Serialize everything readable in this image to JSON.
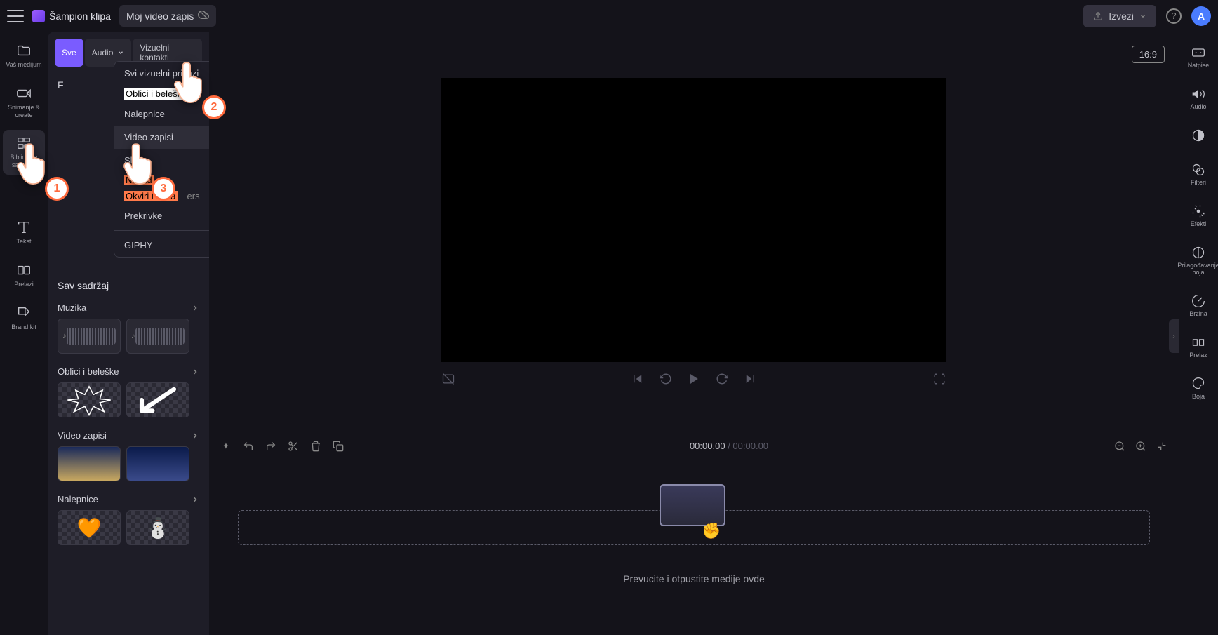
{
  "header": {
    "app_name": "Šampion klipa",
    "project_name": "Moj video zapis",
    "export_label": "Izvezi",
    "avatar_letter": "A"
  },
  "left_rail": [
    {
      "label": "Vaš medijum",
      "icon": "folder"
    },
    {
      "label": "Snimanje &amp; create",
      "icon": "camera"
    },
    {
      "label": "Biblioteka sadržaja",
      "icon": "library",
      "active": true
    },
    {
      "label": "",
      "icon": "spacer"
    },
    {
      "label": "Tekst",
      "icon": "text"
    },
    {
      "label": "Prelazi",
      "icon": "transitions"
    },
    {
      "label": "Brand kit",
      "icon": "brandkit"
    }
  ],
  "filter_tabs": {
    "all": "Sve",
    "audio": "Audio",
    "visuals": "Vizuelni kontakti"
  },
  "dropdown": {
    "items": [
      {
        "label": "Svi vizuelni prikazi",
        "style": "normal"
      },
      {
        "label": "Oblici i beleška",
        "style": "highlighted-white"
      },
      {
        "label": "Nalepnice",
        "style": "normal"
      },
      {
        "label": "Video zapisi",
        "style": "hovered"
      },
      {
        "label": "Slike",
        "style": "normal"
      },
      {
        "label": "Nazad",
        "style": "highlighted-orange"
      },
      {
        "label": "Okviri i tabla",
        "style": "highlighted-orange",
        "suffix": "ers"
      },
      {
        "label": "Prekrivke",
        "style": "normal"
      },
      {
        "label": "GIPHY",
        "style": "normal-sep"
      }
    ]
  },
  "side_panel": {
    "F_label": "F",
    "all_content_label": "Sav sadržaj",
    "categories": [
      {
        "name": "Muzika",
        "thumbs": [
          "audio",
          "audio"
        ]
      },
      {
        "name": "Oblici i beleške",
        "thumbs": [
          "starburst",
          "arrow"
        ]
      },
      {
        "name": "Video zapisi",
        "thumbs": [
          "city1",
          "city2"
        ]
      },
      {
        "name": "Nalepnice",
        "thumbs": [
          "sticker1",
          "sticker2"
        ]
      }
    ]
  },
  "preview": {
    "aspect_label": "16:9"
  },
  "timeline": {
    "current": "00:00.00",
    "duration": "00:00.00",
    "drop_hint": "Prevucite i otpustite medije ovde"
  },
  "right_rail": [
    {
      "label": "Natpise",
      "icon": "cc"
    },
    {
      "label": "Audio",
      "icon": "audio"
    },
    {
      "label": "",
      "icon": "fade"
    },
    {
      "label": "Filteri",
      "icon": "filters"
    },
    {
      "label": "Efekti",
      "icon": "effects"
    },
    {
      "label": "Prilagođavanje boja",
      "icon": "coloradj"
    },
    {
      "label": "Brzina",
      "icon": "speed"
    },
    {
      "label": "Prelaz",
      "icon": "transition"
    },
    {
      "label": "Boja",
      "icon": "color"
    }
  ],
  "callouts": {
    "one": "1",
    "two": "2",
    "three": "3"
  }
}
